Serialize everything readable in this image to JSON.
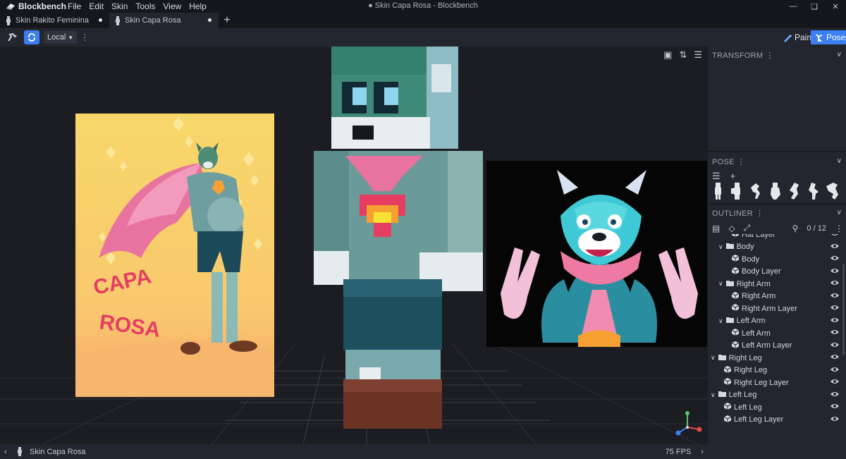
{
  "app": {
    "name": "Blockbench",
    "window_title": "● Skin Capa Rosa - Blockbench"
  },
  "menu": [
    "File",
    "Edit",
    "Skin",
    "Tools",
    "View",
    "Help"
  ],
  "tabs": [
    {
      "label": "Skin Rakito Feminina",
      "active": false
    },
    {
      "label": "Skin Capa Rosa",
      "active": true
    }
  ],
  "toolbar": {
    "space": "Local"
  },
  "modes": {
    "paint": "Paint",
    "pose": "Pose"
  },
  "panels": {
    "transform": "TRANSFORM",
    "pose": "POSE",
    "outliner": "OUTLINER"
  },
  "outliner": {
    "count": "0 / 12",
    "rows": [
      {
        "label": "Hat Layer",
        "kind": "cube",
        "indent": 2
      },
      {
        "label": "Body",
        "kind": "group",
        "indent": 1
      },
      {
        "label": "Body",
        "kind": "cube",
        "indent": 2
      },
      {
        "label": "Body Layer",
        "kind": "cube",
        "indent": 2
      },
      {
        "label": "Right Arm",
        "kind": "group",
        "indent": 1
      },
      {
        "label": "Right Arm",
        "kind": "cube",
        "indent": 2
      },
      {
        "label": "Right Arm Layer",
        "kind": "cube",
        "indent": 2
      },
      {
        "label": "Left Arm",
        "kind": "group",
        "indent": 1
      },
      {
        "label": "Left Arm",
        "kind": "cube",
        "indent": 2
      },
      {
        "label": "Left Arm Layer",
        "kind": "cube",
        "indent": 2
      },
      {
        "label": "Right Leg",
        "kind": "group",
        "indent": 0
      },
      {
        "label": "Right Leg",
        "kind": "cube",
        "indent": 1
      },
      {
        "label": "Right Leg Layer",
        "kind": "cube",
        "indent": 1
      },
      {
        "label": "Left Leg",
        "kind": "group",
        "indent": 0
      },
      {
        "label": "Left Leg",
        "kind": "cube",
        "indent": 1
      },
      {
        "label": "Left Leg Layer",
        "kind": "cube",
        "indent": 1
      }
    ]
  },
  "reference_art": {
    "word1": "CAPA",
    "word2": "ROSA"
  },
  "status": {
    "project": "Skin Capa Rosa",
    "fps": "75 FPS"
  },
  "colors": {
    "accent": "#3c7ff0",
    "pink": "#e8739e",
    "teal": "#5c9a93",
    "bg": "#1b1d24"
  }
}
